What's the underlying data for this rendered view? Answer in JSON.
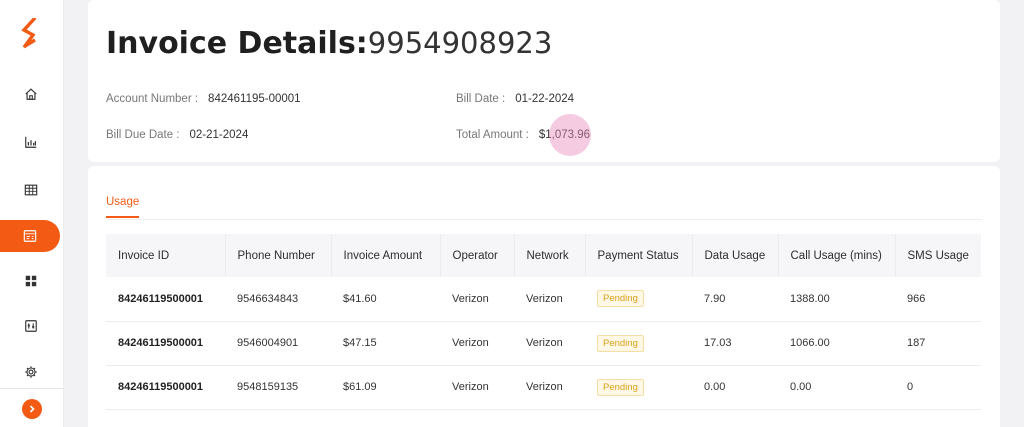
{
  "header": {
    "title_label": "Invoice Details:",
    "title_value": "9954908923",
    "account_number_label": "Account Number :",
    "account_number": "842461195-00001",
    "bill_date_label": "Bill Date :",
    "bill_date": "01-22-2024",
    "bill_due_date_label": "Bill Due Date :",
    "bill_due_date": "02-21-2024",
    "total_amount_label": "Total Amount :",
    "total_amount": "$1,073.96"
  },
  "sidebar": {
    "items": [
      {
        "icon": "home-icon"
      },
      {
        "icon": "bar-chart-icon"
      },
      {
        "icon": "table-icon"
      },
      {
        "icon": "invoice-icon",
        "active": true
      },
      {
        "icon": "grid-icon"
      },
      {
        "icon": "report-icon"
      },
      {
        "icon": "gear-icon"
      }
    ],
    "accent": "#f35a14"
  },
  "tabs": [
    {
      "label": "Usage",
      "active": true
    }
  ],
  "table": {
    "columns": [
      "Invoice ID",
      "Phone Number",
      "Invoice Amount",
      "Operator",
      "Network",
      "Payment Status",
      "Data Usage",
      "Call Usage (mins)",
      "SMS Usage"
    ],
    "rows": [
      {
        "invoice_id": "84246119500001",
        "phone": "9546634843",
        "amount": "$41.60",
        "operator": "Verizon",
        "network": "Verizon",
        "status": "Pending",
        "data": "7.90",
        "call": "1388.00",
        "sms": "966"
      },
      {
        "invoice_id": "84246119500001",
        "phone": "9546004901",
        "amount": "$47.15",
        "operator": "Verizon",
        "network": "Verizon",
        "status": "Pending",
        "data": "17.03",
        "call": "1066.00",
        "sms": "187"
      },
      {
        "invoice_id": "84246119500001",
        "phone": "9548159135",
        "amount": "$61.09",
        "operator": "Verizon",
        "network": "Verizon",
        "status": "Pending",
        "data": "0.00",
        "call": "0.00",
        "sms": "0"
      }
    ]
  }
}
